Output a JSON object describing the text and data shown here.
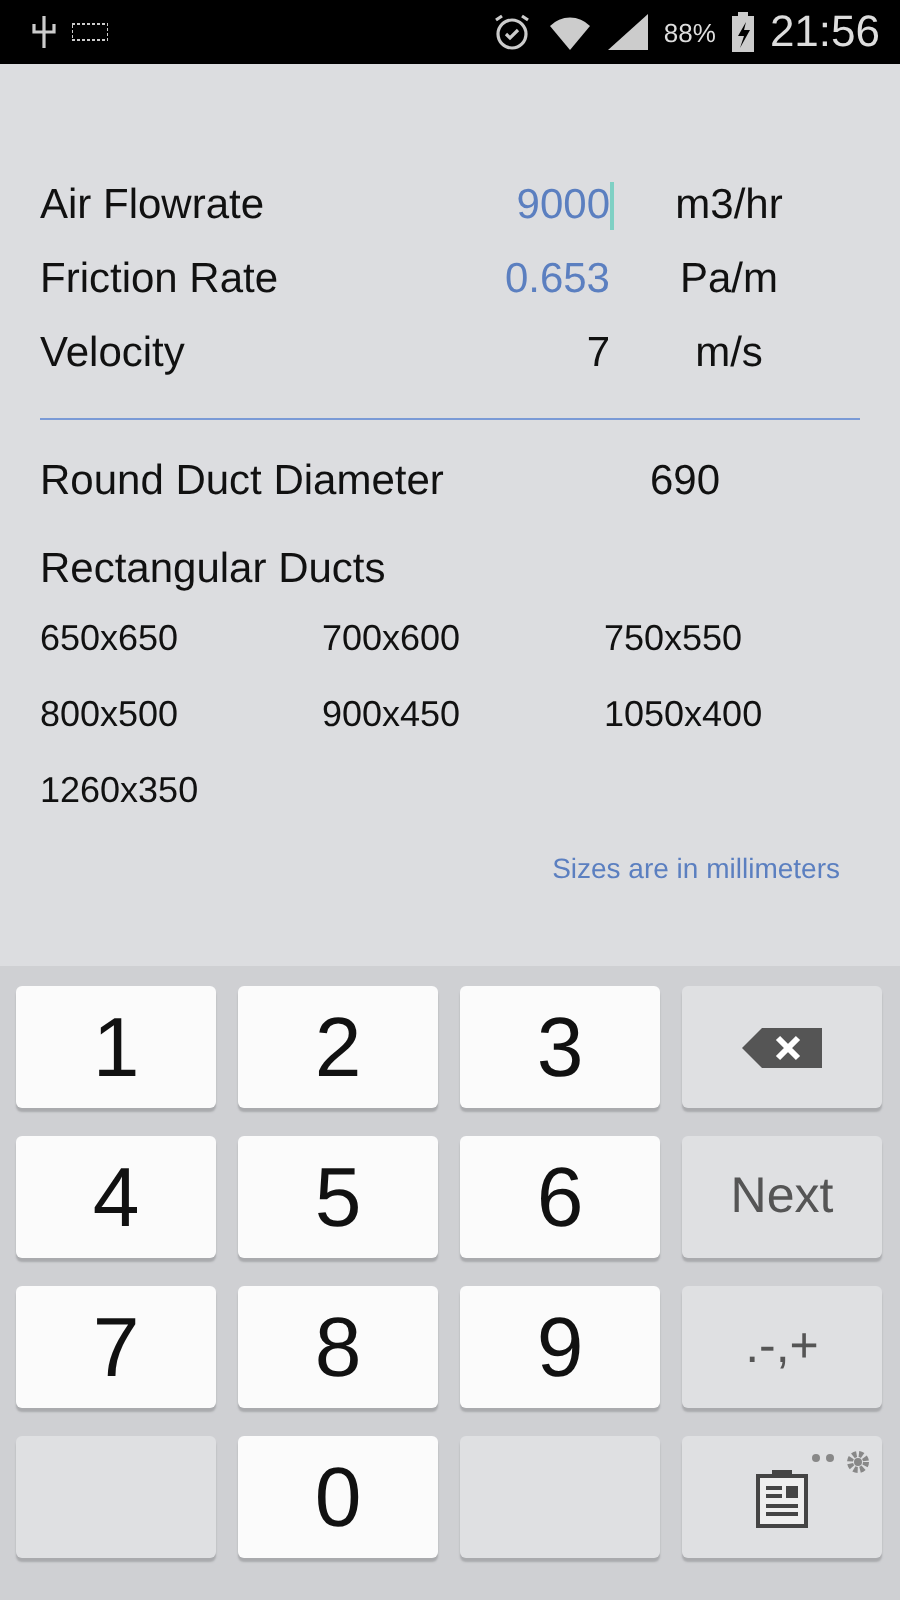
{
  "status_bar": {
    "battery": "88%",
    "time": "21:56"
  },
  "inputs": [
    {
      "label": "Air Flowrate",
      "value": "9000",
      "unit": "m3/hr",
      "kind": "input",
      "focused": true
    },
    {
      "label": "Friction Rate",
      "value": "0.653",
      "unit": "Pa/m",
      "kind": "input",
      "focused": false
    },
    {
      "label": "Velocity",
      "value": "7",
      "unit": "m/s",
      "kind": "output",
      "focused": false
    }
  ],
  "round_duct": {
    "label": "Round Duct Diameter",
    "value": "690"
  },
  "rectangular": {
    "title": "Rectangular Ducts",
    "sizes": [
      "650x650",
      "700x600",
      "750x550",
      "800x500",
      "900x450",
      "1050x400",
      "1260x350"
    ]
  },
  "note": "Sizes are in millimeters",
  "keypad": [
    {
      "kind": "digit",
      "label": "1"
    },
    {
      "kind": "digit",
      "label": "2"
    },
    {
      "kind": "digit",
      "label": "3"
    },
    {
      "kind": "backspace"
    },
    {
      "kind": "digit",
      "label": "4"
    },
    {
      "kind": "digit",
      "label": "5"
    },
    {
      "kind": "digit",
      "label": "6"
    },
    {
      "kind": "action",
      "label": "Next"
    },
    {
      "kind": "digit",
      "label": "7"
    },
    {
      "kind": "digit",
      "label": "8"
    },
    {
      "kind": "digit",
      "label": "9"
    },
    {
      "kind": "action",
      "label": ".-,+"
    },
    {
      "kind": "blank"
    },
    {
      "kind": "digit",
      "label": "0"
    },
    {
      "kind": "blank"
    },
    {
      "kind": "clipboard"
    }
  ]
}
